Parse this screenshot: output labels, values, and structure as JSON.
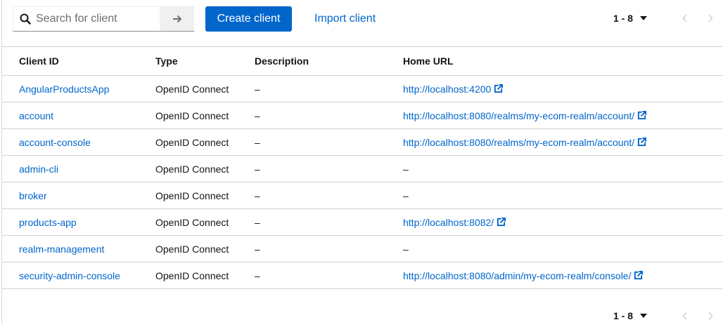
{
  "toolbar": {
    "search_placeholder": "Search for client",
    "create_label": "Create client",
    "import_label": "Import client"
  },
  "pagination": {
    "range": "1 - 8"
  },
  "table": {
    "columns": [
      "Client ID",
      "Type",
      "Description",
      "Home URL"
    ],
    "rows": [
      {
        "client_id": "AngularProductsApp",
        "type": "OpenID Connect",
        "description": "–",
        "home_url": "http://localhost:4200"
      },
      {
        "client_id": "account",
        "type": "OpenID Connect",
        "description": "–",
        "home_url": "http://localhost:8080/realms/my-ecom-realm/account/"
      },
      {
        "client_id": "account-console",
        "type": "OpenID Connect",
        "description": "–",
        "home_url": "http://localhost:8080/realms/my-ecom-realm/account/"
      },
      {
        "client_id": "admin-cli",
        "type": "OpenID Connect",
        "description": "–",
        "home_url": "–"
      },
      {
        "client_id": "broker",
        "type": "OpenID Connect",
        "description": "–",
        "home_url": "–"
      },
      {
        "client_id": "products-app",
        "type": "OpenID Connect",
        "description": "–",
        "home_url": "http://localhost:8082/"
      },
      {
        "client_id": "realm-management",
        "type": "OpenID Connect",
        "description": "–",
        "home_url": "–"
      },
      {
        "client_id": "security-admin-console",
        "type": "OpenID Connect",
        "description": "–",
        "home_url": "http://localhost:8080/admin/my-ecom-realm/console/"
      }
    ]
  },
  "icons": {
    "search": "search-icon",
    "arrow": "arrow-right-icon",
    "caret": "caret-down-icon",
    "prev": "chevron-left-icon",
    "next": "chevron-right-icon",
    "external": "external-link-icon"
  },
  "colors": {
    "primary": "#0066cc",
    "link": "#0066cc",
    "border": "#d2d2d2"
  }
}
